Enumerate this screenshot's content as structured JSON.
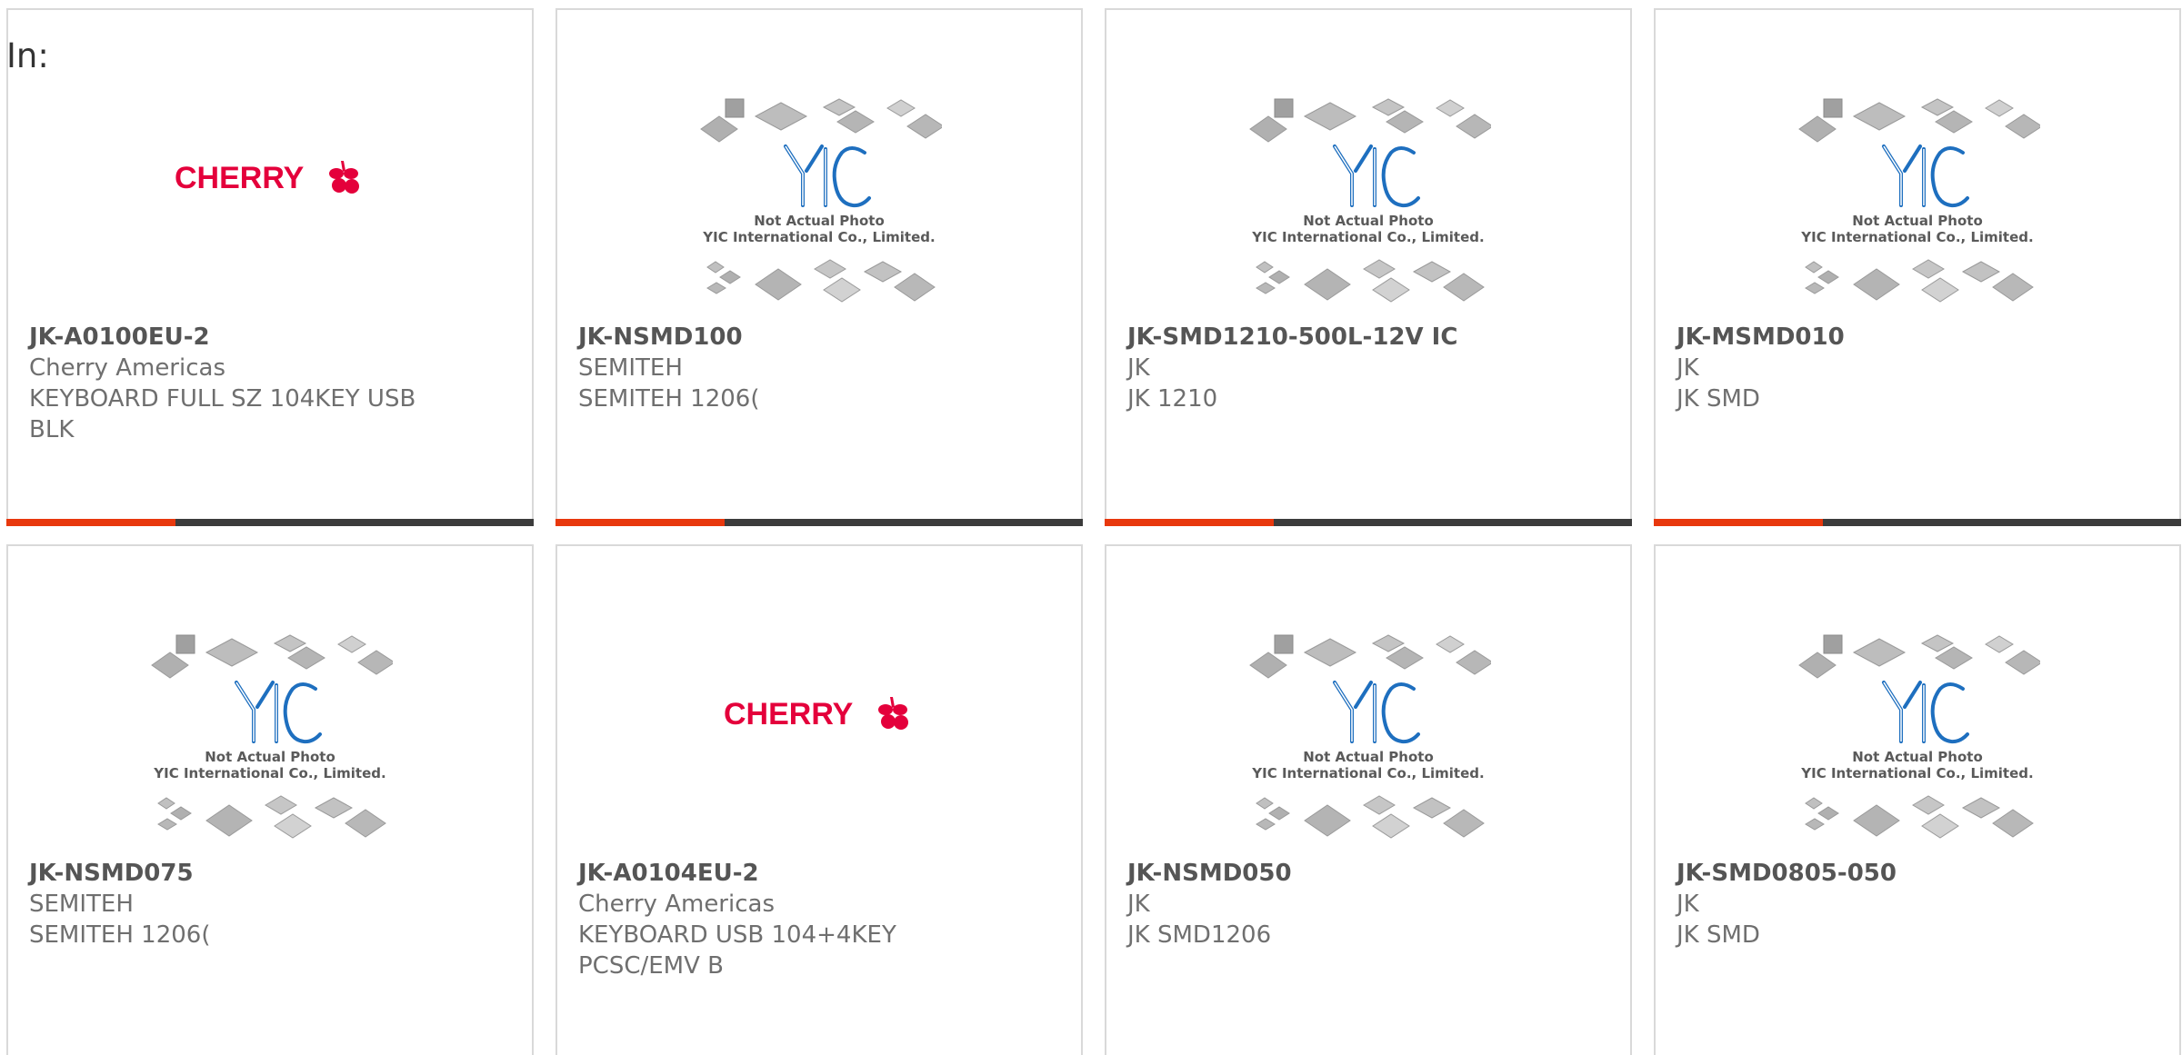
{
  "page": {
    "in_label": "In:"
  },
  "colors": {
    "accent": "#e8380d",
    "bar_dark": "#3c3c3c",
    "cherry_red": "#e4003b",
    "yic_blue": "#1e6fbf"
  },
  "placeholder": {
    "line1": "Not Actual Photo",
    "line2": "YIC International Co., Limited."
  },
  "logos": {
    "cherry": "CHERRY"
  },
  "products": [
    {
      "part_number": "JK-A0100EU-2",
      "manufacturer": "Cherry Americas",
      "description": "KEYBOARD FULL SZ 104KEY USB BLK",
      "image": "cherry-logo",
      "accent_bar": true
    },
    {
      "part_number": "JK-NSMD100",
      "manufacturer": "SEMITEH",
      "description": "SEMITEH 1206(",
      "image": "yic-placeholder",
      "accent_bar": true
    },
    {
      "part_number": "JK-SMD1210-500L-12V IC",
      "manufacturer": "JK",
      "description": "JK 1210",
      "image": "yic-placeholder",
      "accent_bar": true
    },
    {
      "part_number": "JK-MSMD010",
      "manufacturer": "JK",
      "description": "JK SMD",
      "image": "yic-placeholder",
      "accent_bar": true
    },
    {
      "part_number": "JK-NSMD075",
      "manufacturer": "SEMITEH",
      "description": "SEMITEH 1206(",
      "image": "yic-placeholder",
      "accent_bar": false
    },
    {
      "part_number": "JK-A0104EU-2",
      "manufacturer": "Cherry Americas",
      "description": "KEYBOARD USB 104+4KEY PCSC/EMV B",
      "image": "cherry-logo",
      "accent_bar": false
    },
    {
      "part_number": "JK-NSMD050",
      "manufacturer": "JK",
      "description": "JK SMD1206",
      "image": "yic-placeholder",
      "accent_bar": false
    },
    {
      "part_number": "JK-SMD0805-050",
      "manufacturer": "JK",
      "description": "JK SMD",
      "image": "yic-placeholder",
      "accent_bar": false
    }
  ]
}
